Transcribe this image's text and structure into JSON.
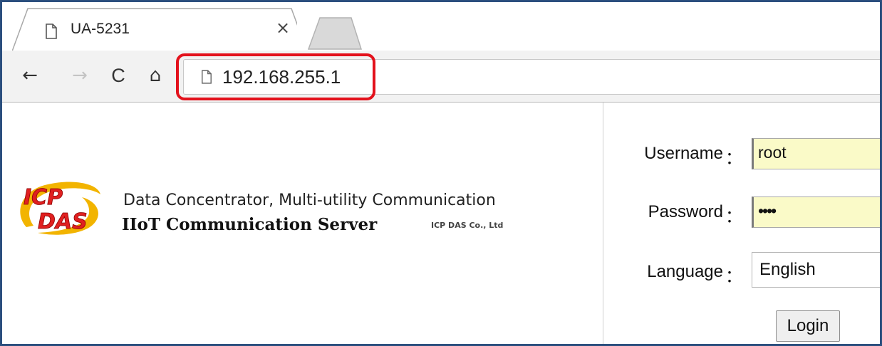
{
  "browser": {
    "tab": {
      "title": "UA-5231",
      "close_glyph": "×",
      "icon": "page-icon"
    },
    "new_tab": {
      "icon": "new-tab-icon"
    },
    "nav": {
      "back_glyph": "←",
      "forward_glyph": "→",
      "reload_glyph": "C",
      "home_glyph": "⌂"
    },
    "address_bar": {
      "url": "192.168.255.1",
      "icon": "page-icon"
    },
    "highlight_color": "#e3121c",
    "frame_color": "#2b4f7e"
  },
  "page": {
    "logo": {
      "icon": "icp-das-logo",
      "text_top": "ICP",
      "text_bottom": "DAS"
    },
    "tagline": "Data Concentrator, Multi-utility Communication",
    "product_name": "IIoT Communication Server",
    "company": "ICP DAS Co., Ltd",
    "form": {
      "username_label": "Username",
      "username_value": "root",
      "password_label": "Password",
      "password_value": "••••",
      "language_label": "Language",
      "language_value": "English",
      "colon": "：",
      "login_label": "Login",
      "input_bg_color": "#fafac8"
    }
  }
}
